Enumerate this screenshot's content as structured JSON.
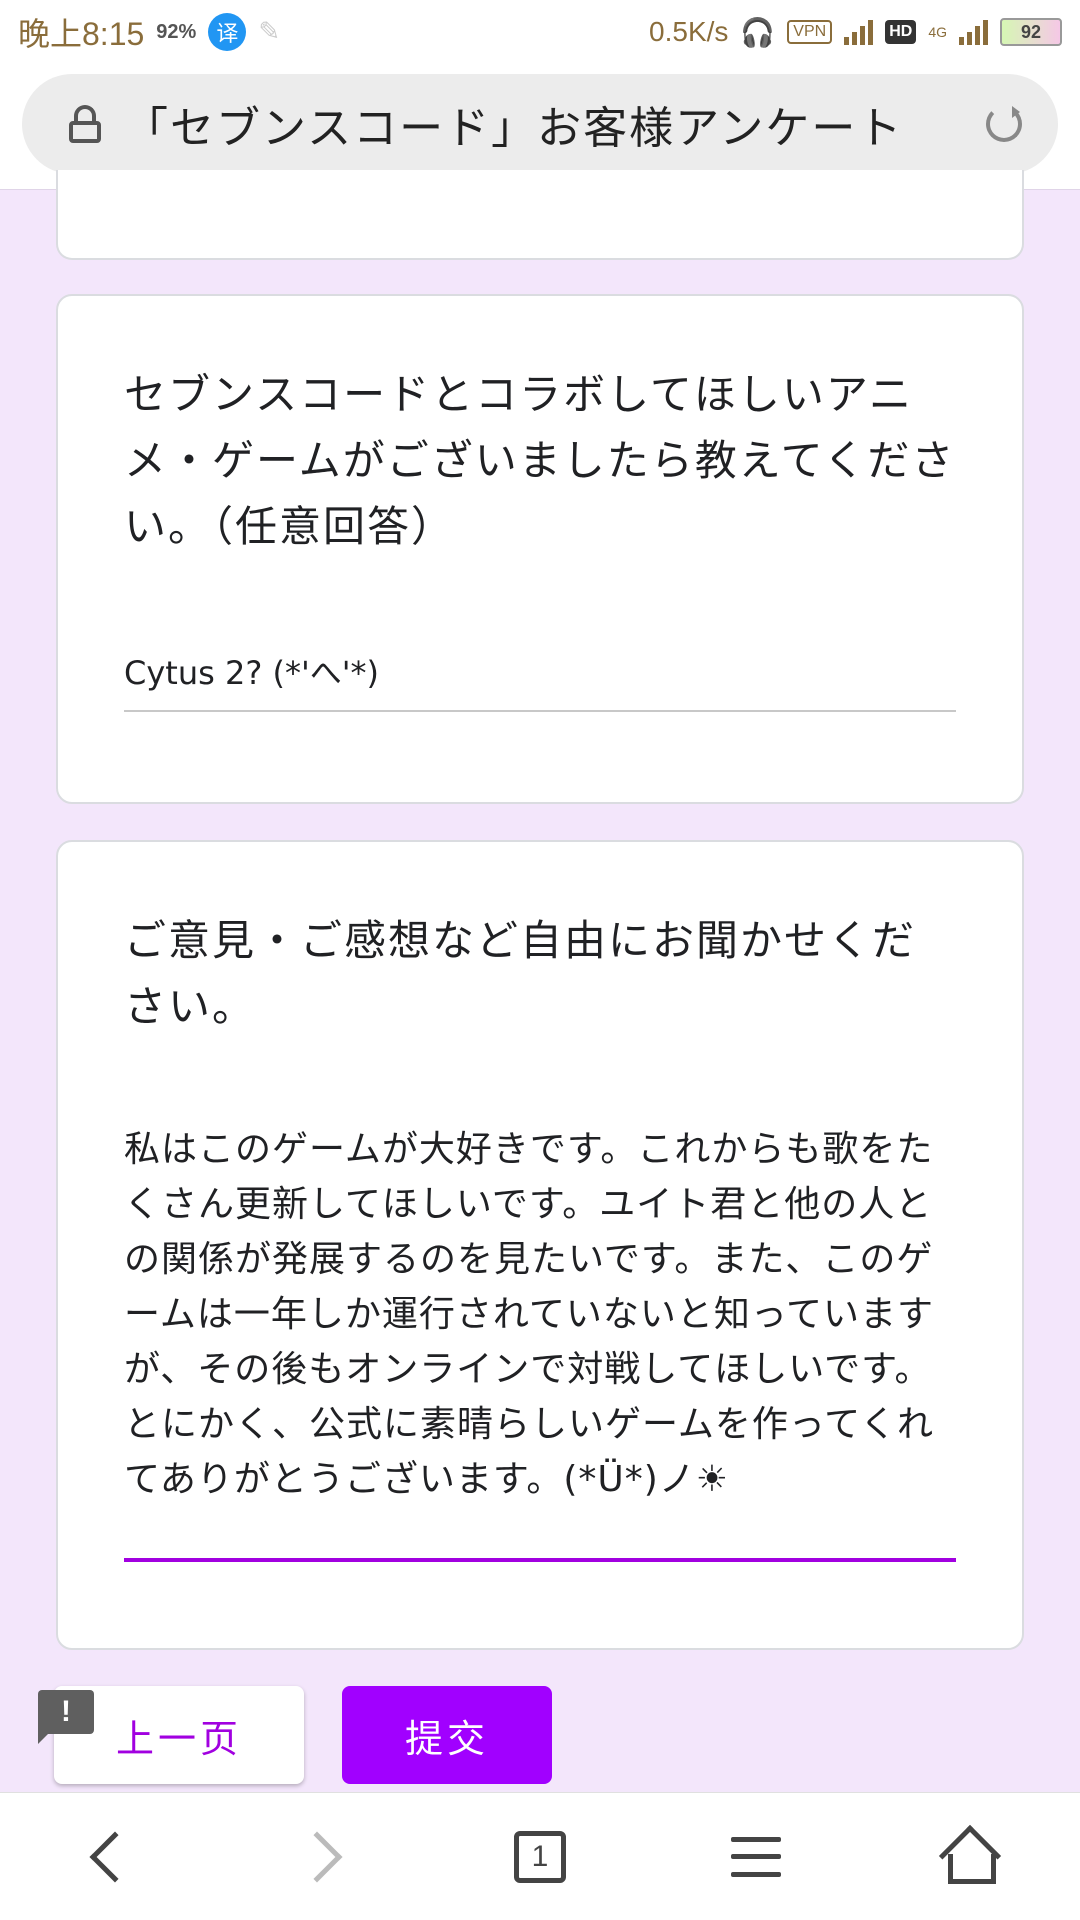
{
  "status_bar": {
    "time": "晚上8:15",
    "data_badge": "92%",
    "translate_icon_label": "译",
    "net_speed": "0.5K/s",
    "vpn_label": "VPN",
    "hd_label": "HD",
    "network_type": "4G",
    "battery": "92"
  },
  "address_bar": {
    "title": "「セブンスコード」お客様アンケート"
  },
  "questions": [
    {
      "text": "セブンスコードとコラボしてほしいアニメ・ゲームがございましたら教えてください。（任意回答）",
      "answer": "Cytus 2? (*'へ'*)"
    },
    {
      "text": "ご意見・ご感想など自由にお聞かせください。",
      "answer": "私はこのゲームが大好きです。これからも歌をたくさん更新してほしいです。ユイト君と他の人との関係が発展するのを見たいです。また、このゲームは一年しか運行されていないと知っていますが、その後もオンラインで対戦してほしいです。とにかく、公式に素晴らしいゲームを作ってくれてありがとうございます。(*Ü*)ノ☀"
    }
  ],
  "buttons": {
    "prev": "上一页",
    "submit": "提交"
  },
  "feedback_icon_glyph": "!",
  "bottom_nav": {
    "tabs_count": "1"
  },
  "colors": {
    "accent": "#a100ff",
    "page_background": "#f3e6fb"
  }
}
